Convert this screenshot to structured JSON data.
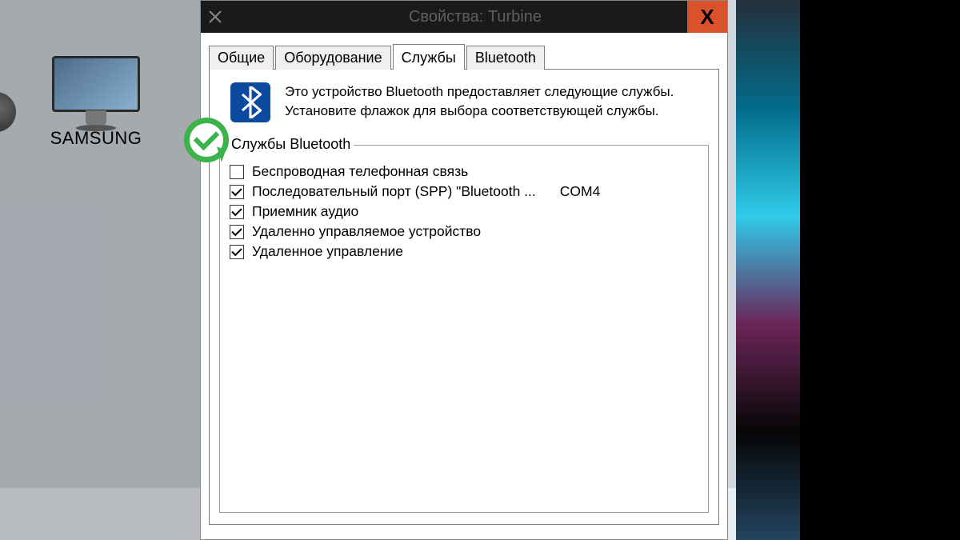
{
  "desktop": {
    "icon_label": "SAMSUNG"
  },
  "dialog": {
    "title": "Свойства: Turbine",
    "close_glyph": "X",
    "tabs": [
      {
        "label": "Общие"
      },
      {
        "label": "Оборудование"
      },
      {
        "label": "Службы"
      },
      {
        "label": "Bluetooth"
      }
    ],
    "active_tab": 2,
    "intro_line1": "Это устройство Bluetooth предоставляет следующие службы.",
    "intro_line2": "Установите флажок для выбора соответствующей службы.",
    "fieldset_legend": "Службы Bluetooth",
    "services": [
      {
        "checked": false,
        "label": "Беспроводная телефонная связь",
        "extra": ""
      },
      {
        "checked": true,
        "label": "Последовательный порт (SPP) \"Bluetooth ...",
        "extra": "COM4"
      },
      {
        "checked": true,
        "label": "Приемник аудио",
        "extra": ""
      },
      {
        "checked": true,
        "label": "Удаленно управляемое устройство",
        "extra": ""
      },
      {
        "checked": true,
        "label": "Удаленное управление",
        "extra": ""
      }
    ]
  }
}
